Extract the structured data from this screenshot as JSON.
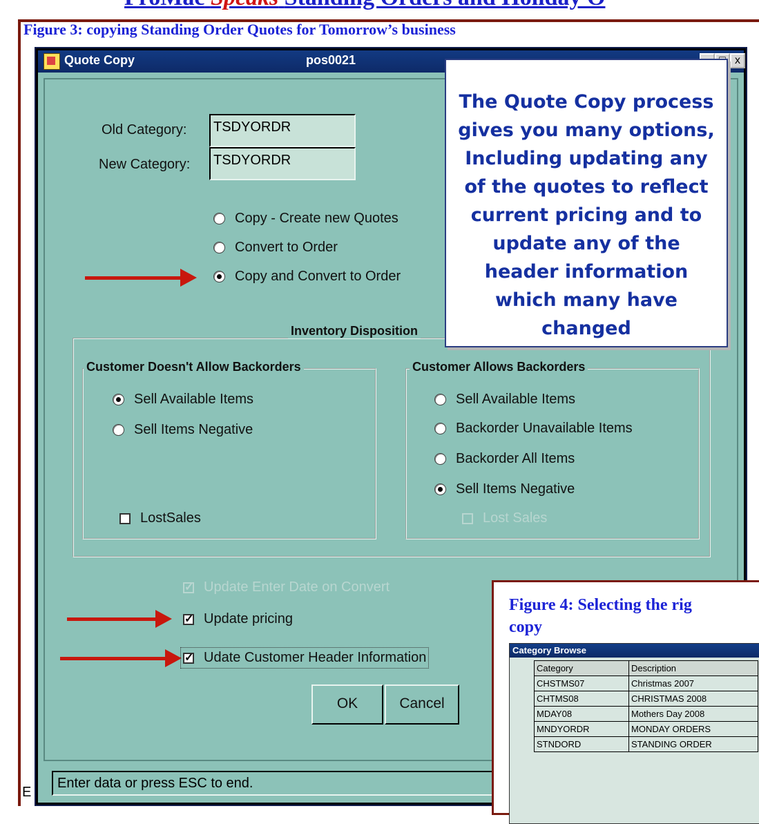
{
  "doc": {
    "title_left": "ProMac",
    "title_mid": "Speaks",
    "title_right": "Standing Orders and Holiday O",
    "figure3_caption": "Figure 3: copying Standing Order Quotes for Tomorrow’s business",
    "stray_text": "E"
  },
  "window": {
    "title": "Quote Copy",
    "program_id": "pos0021",
    "buttons": {
      "min": "_",
      "max": "□",
      "close": "x"
    }
  },
  "form": {
    "old_category_label": "Old Category:",
    "old_category_value": "TSDYORDR",
    "new_category_label": "New Category:",
    "new_category_value": "TSDYORDR",
    "mode_options": [
      {
        "label": "Copy - Create new Quotes",
        "selected": false
      },
      {
        "label": "Convert to Order",
        "selected": false
      },
      {
        "label": "Copy and Convert to Order",
        "selected": true
      }
    ],
    "inventory_group_label": "Inventory Disposition",
    "no_backorder_group": {
      "label": "Customer Doesn't Allow Backorders",
      "options": [
        {
          "label": "Sell Available Items",
          "selected": true
        },
        {
          "label": "Sell Items Negative",
          "selected": false
        }
      ],
      "lostsales_label": "LostSales",
      "lostsales_checked": false
    },
    "backorder_group": {
      "label": "Customer Allows Backorders",
      "options": [
        {
          "label": "Sell Available Items",
          "selected": false
        },
        {
          "label": "Backorder Unavailable Items",
          "selected": false
        },
        {
          "label": "Backorder All Items",
          "selected": false
        },
        {
          "label": "Sell Items Negative",
          "selected": true
        }
      ],
      "lostsales_label": "Lost Sales",
      "lostsales_checked": false
    },
    "update_enter_date_label": "Update Enter Date on Convert",
    "update_enter_date_checked": true,
    "update_pricing_label": "Update pricing",
    "update_pricing_checked": true,
    "update_header_label": "Udate Customer Header Information",
    "update_header_checked": true,
    "ok_label": "OK",
    "cancel_label": "Cancel",
    "status_text": "Enter data or press ESC to end.",
    "check_glyph": "✓"
  },
  "callout": {
    "text": "The Quote Copy process gives you many options, Including updating any of the quotes to reflect current pricing and to update any of the header information which many have changed"
  },
  "figure4": {
    "caption_line1": "Figure 4: Selecting the  rig",
    "caption_line2": "copy",
    "window_title": "Category Browse",
    "columns": [
      "Category",
      "Description"
    ],
    "rows": [
      [
        "CHSTMS07",
        "Christmas 2007"
      ],
      [
        "CHTMS08",
        "CHRISTMAS 2008"
      ],
      [
        "MDAY08",
        "Mothers Day 2008"
      ],
      [
        "MNDYORDR",
        "MONDAY ORDERS"
      ],
      [
        "STNDORD",
        "STANDING ORDER"
      ]
    ]
  },
  "colors": {
    "window_bg": "#8cc2b8",
    "titlebar": "#123a82",
    "arrow": "#c8170d",
    "caption_blue": "#1c23d6",
    "frame": "#7a1a0e"
  }
}
